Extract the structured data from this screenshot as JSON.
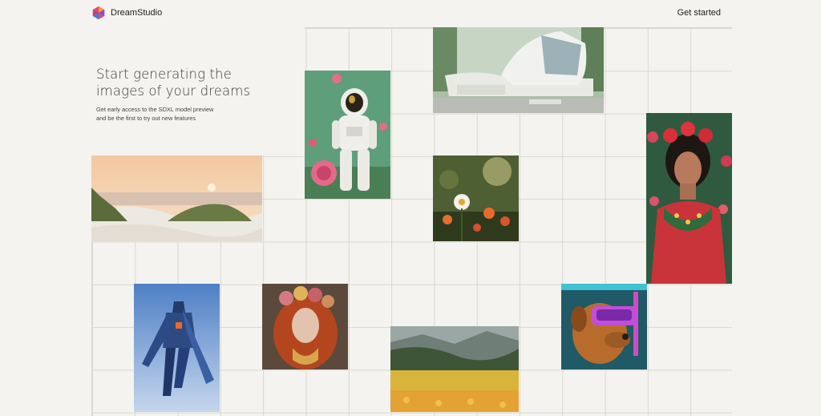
{
  "header": {
    "brand": "DreamStudio",
    "cta_label": "Get started"
  },
  "hero": {
    "title_line1": "Start generating the",
    "title_line2": "images of your dreams",
    "subtitle_line1": "Get early access to the SDXL model preview",
    "subtitle_line2": "and be the first to try out new features"
  },
  "gallery": [
    {
      "name": "astronaut-in-roses-image"
    },
    {
      "name": "modern-house-image"
    },
    {
      "name": "woman-portrait-flowers-image"
    },
    {
      "name": "beach-dunes-sunset-image"
    },
    {
      "name": "wildflowers-bokeh-image"
    },
    {
      "name": "armored-superhero-image"
    },
    {
      "name": "red-hair-woman-floral-crown-image"
    },
    {
      "name": "flower-field-valley-image"
    },
    {
      "name": "dog-vr-headset-image"
    }
  ],
  "colors": {
    "background": "#f4f3ef",
    "grid_line": "#d9d7d1",
    "text": "#1d1d1d"
  }
}
